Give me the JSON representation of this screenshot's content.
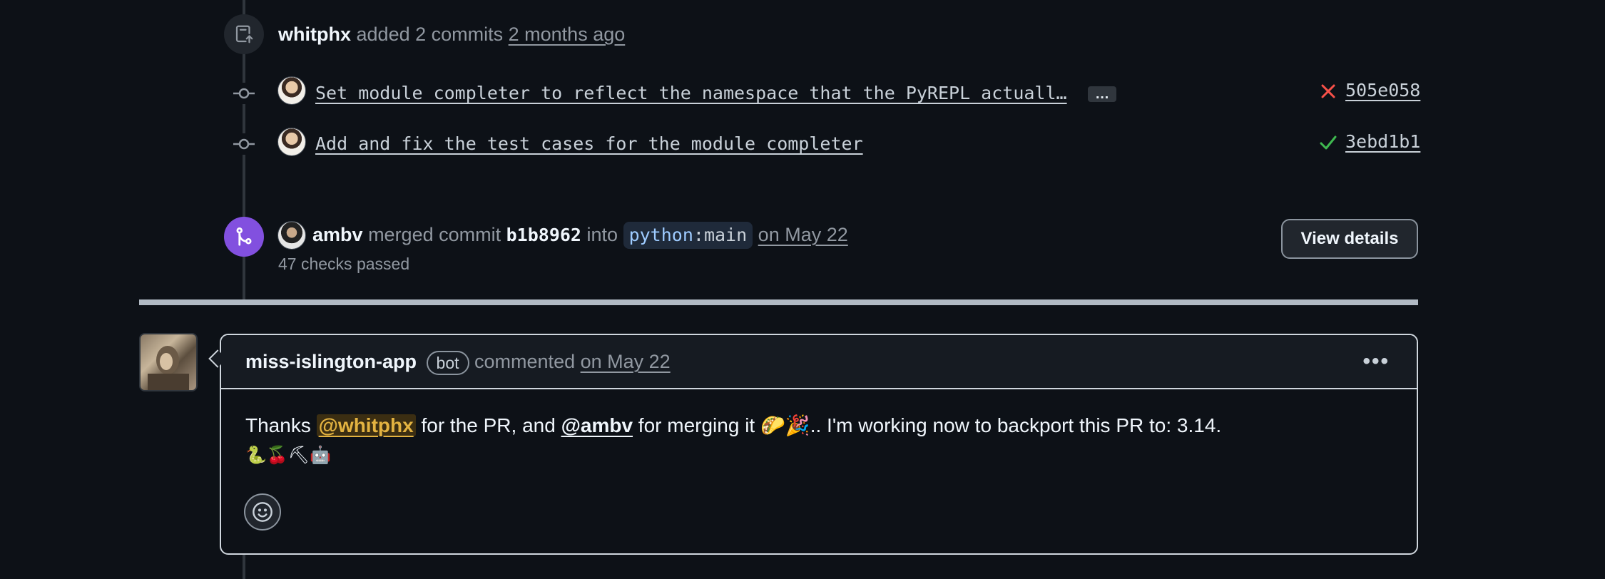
{
  "commits_event": {
    "user": "whitphx",
    "action": "added 2 commits",
    "time": "2 months ago"
  },
  "commits": [
    {
      "message": "Set module_completer to reflect the namespace that the PyREPL actuall…",
      "has_more": true,
      "more_label": "…",
      "status": "failure",
      "status_icon": "x-icon",
      "sha": "505e058"
    },
    {
      "message": "Add and fix the test cases for the module completer",
      "has_more": false,
      "status": "success",
      "status_icon": "check-icon",
      "sha": "3ebd1b1"
    }
  ],
  "merge_event": {
    "user": "ambv",
    "action": "merged commit",
    "commit": "b1b8962",
    "into": "into",
    "branch_repo": "python",
    "branch_sep": ":",
    "branch_name": "main",
    "time": "on May 22",
    "checks": "47 checks passed",
    "button": "View details"
  },
  "comment": {
    "author": "miss-islington-app",
    "badge": "bot",
    "action": "commented",
    "time": "on May 22",
    "body_pre": "Thanks ",
    "mention1": "@whitphx",
    "body_mid": " for the PR, and ",
    "mention2": "@ambv",
    "body_post": " for merging it 🌮🎉.. I'm working now to backport this PR to: 3.14.",
    "body_line2": "🐍🍒⛏🤖"
  },
  "colors": {
    "background": "#0d1117",
    "merged_purple": "#8250df",
    "failure_red": "#f85149",
    "success_green": "#3fb950",
    "mention_yellow": "#e3b341"
  }
}
